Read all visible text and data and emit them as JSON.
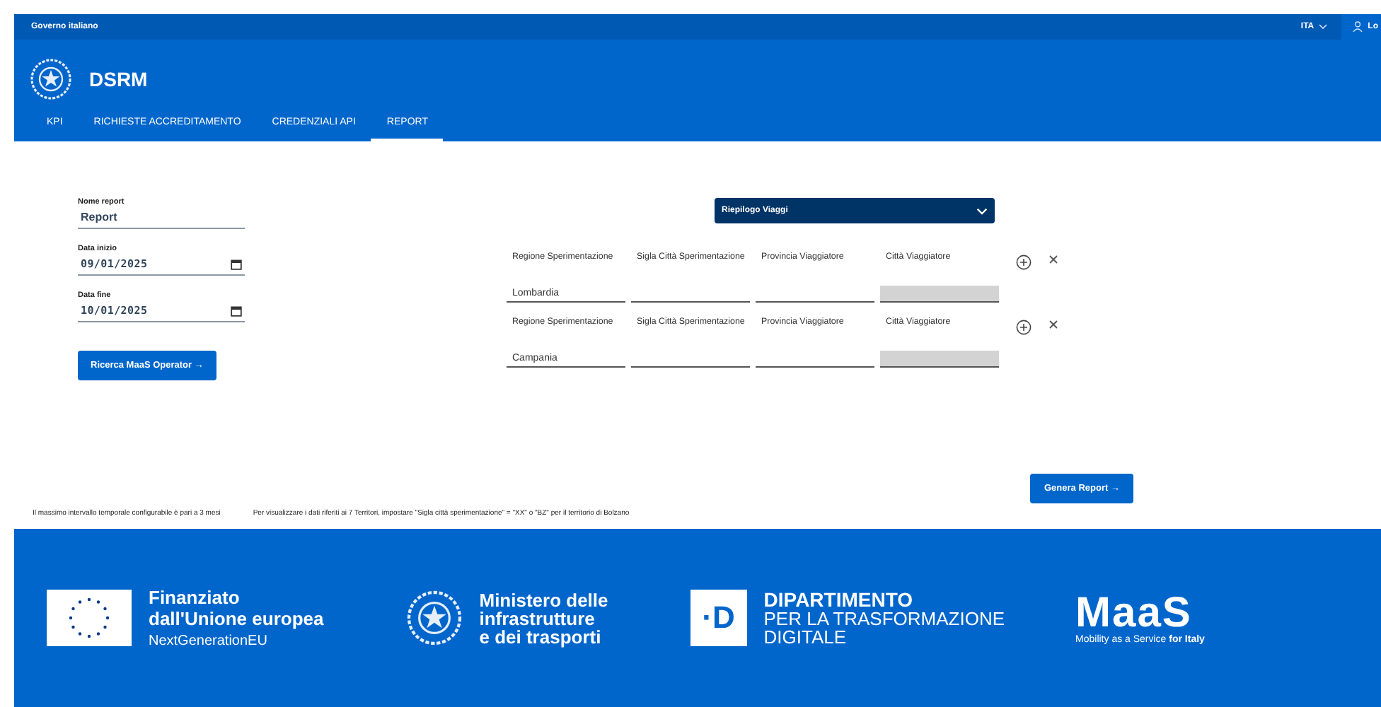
{
  "top_bar": {
    "label": "Governo italiano",
    "language": "ITA",
    "user": "Lo"
  },
  "header": {
    "title": "DSRM"
  },
  "tabs": [
    {
      "label": "KPI",
      "selected": false
    },
    {
      "label": "RICHIESTE ACCREDITAMENTO",
      "selected": false
    },
    {
      "label": "CREDENZIALI API",
      "selected": false
    },
    {
      "label": "REPORT",
      "selected": true
    }
  ],
  "form": {
    "fields": [
      {
        "kind": "text",
        "label": "Nome report",
        "value": "Report"
      },
      {
        "kind": "date",
        "label": "Data inizio",
        "value": "09/01/2025"
      },
      {
        "kind": "date",
        "label": "Data fine",
        "value": "10/01/2025"
      }
    ],
    "search_button": "Ricerca MaaS Operator →"
  },
  "report_type": {
    "value": "Riepilogo Viaggi"
  },
  "filters": [
    {
      "fields": [
        {
          "label": "Regione Sperimentazione",
          "value": "Lombardia",
          "disabled": false
        },
        {
          "label": "Sigla Città Sperimentazione",
          "disabled": false
        },
        {
          "label": "Provincia Viaggiatore",
          "disabled": false
        },
        {
          "label": "Città Viaggiatore",
          "disabled": true
        }
      ]
    },
    {
      "fields": [
        {
          "label": "Regione Sperimentazione",
          "value": "Campania",
          "disabled": false
        },
        {
          "label": "Sigla Città Sperimentazione",
          "disabled": false
        },
        {
          "label": "Provincia Viaggiatore",
          "disabled": false
        },
        {
          "label": "Città Viaggiatore",
          "disabled": true
        }
      ]
    }
  ],
  "generate_button": "Genera Report →",
  "notes": [
    "Il massimo intervallo temporale configurabile è pari a 3 mesi",
    "Per visualizzare i dati riferiti ai 7 Territori, impostare \"Sigla città sperimentazione\" = \"XX\" o \"BZ\" per il territorio di Bolzano"
  ],
  "footer": {
    "eu": {
      "lines": [
        "Finanziato",
        "dall'Unione europea"
      ],
      "sub": "NextGenerationEU"
    },
    "ministry": {
      "lines": [
        "Ministero delle",
        "infrastrutture",
        "e dei trasporti"
      ]
    },
    "department": {
      "mark": "·D",
      "title": "DIPARTIMENTO",
      "lines": [
        "PER LA TRASFORMAZIONE",
        "DIGITALE"
      ]
    },
    "maas": {
      "logo": "MaaS",
      "tagline": "Mobility as a Service",
      "tagline_bold": "for Italy"
    }
  }
}
